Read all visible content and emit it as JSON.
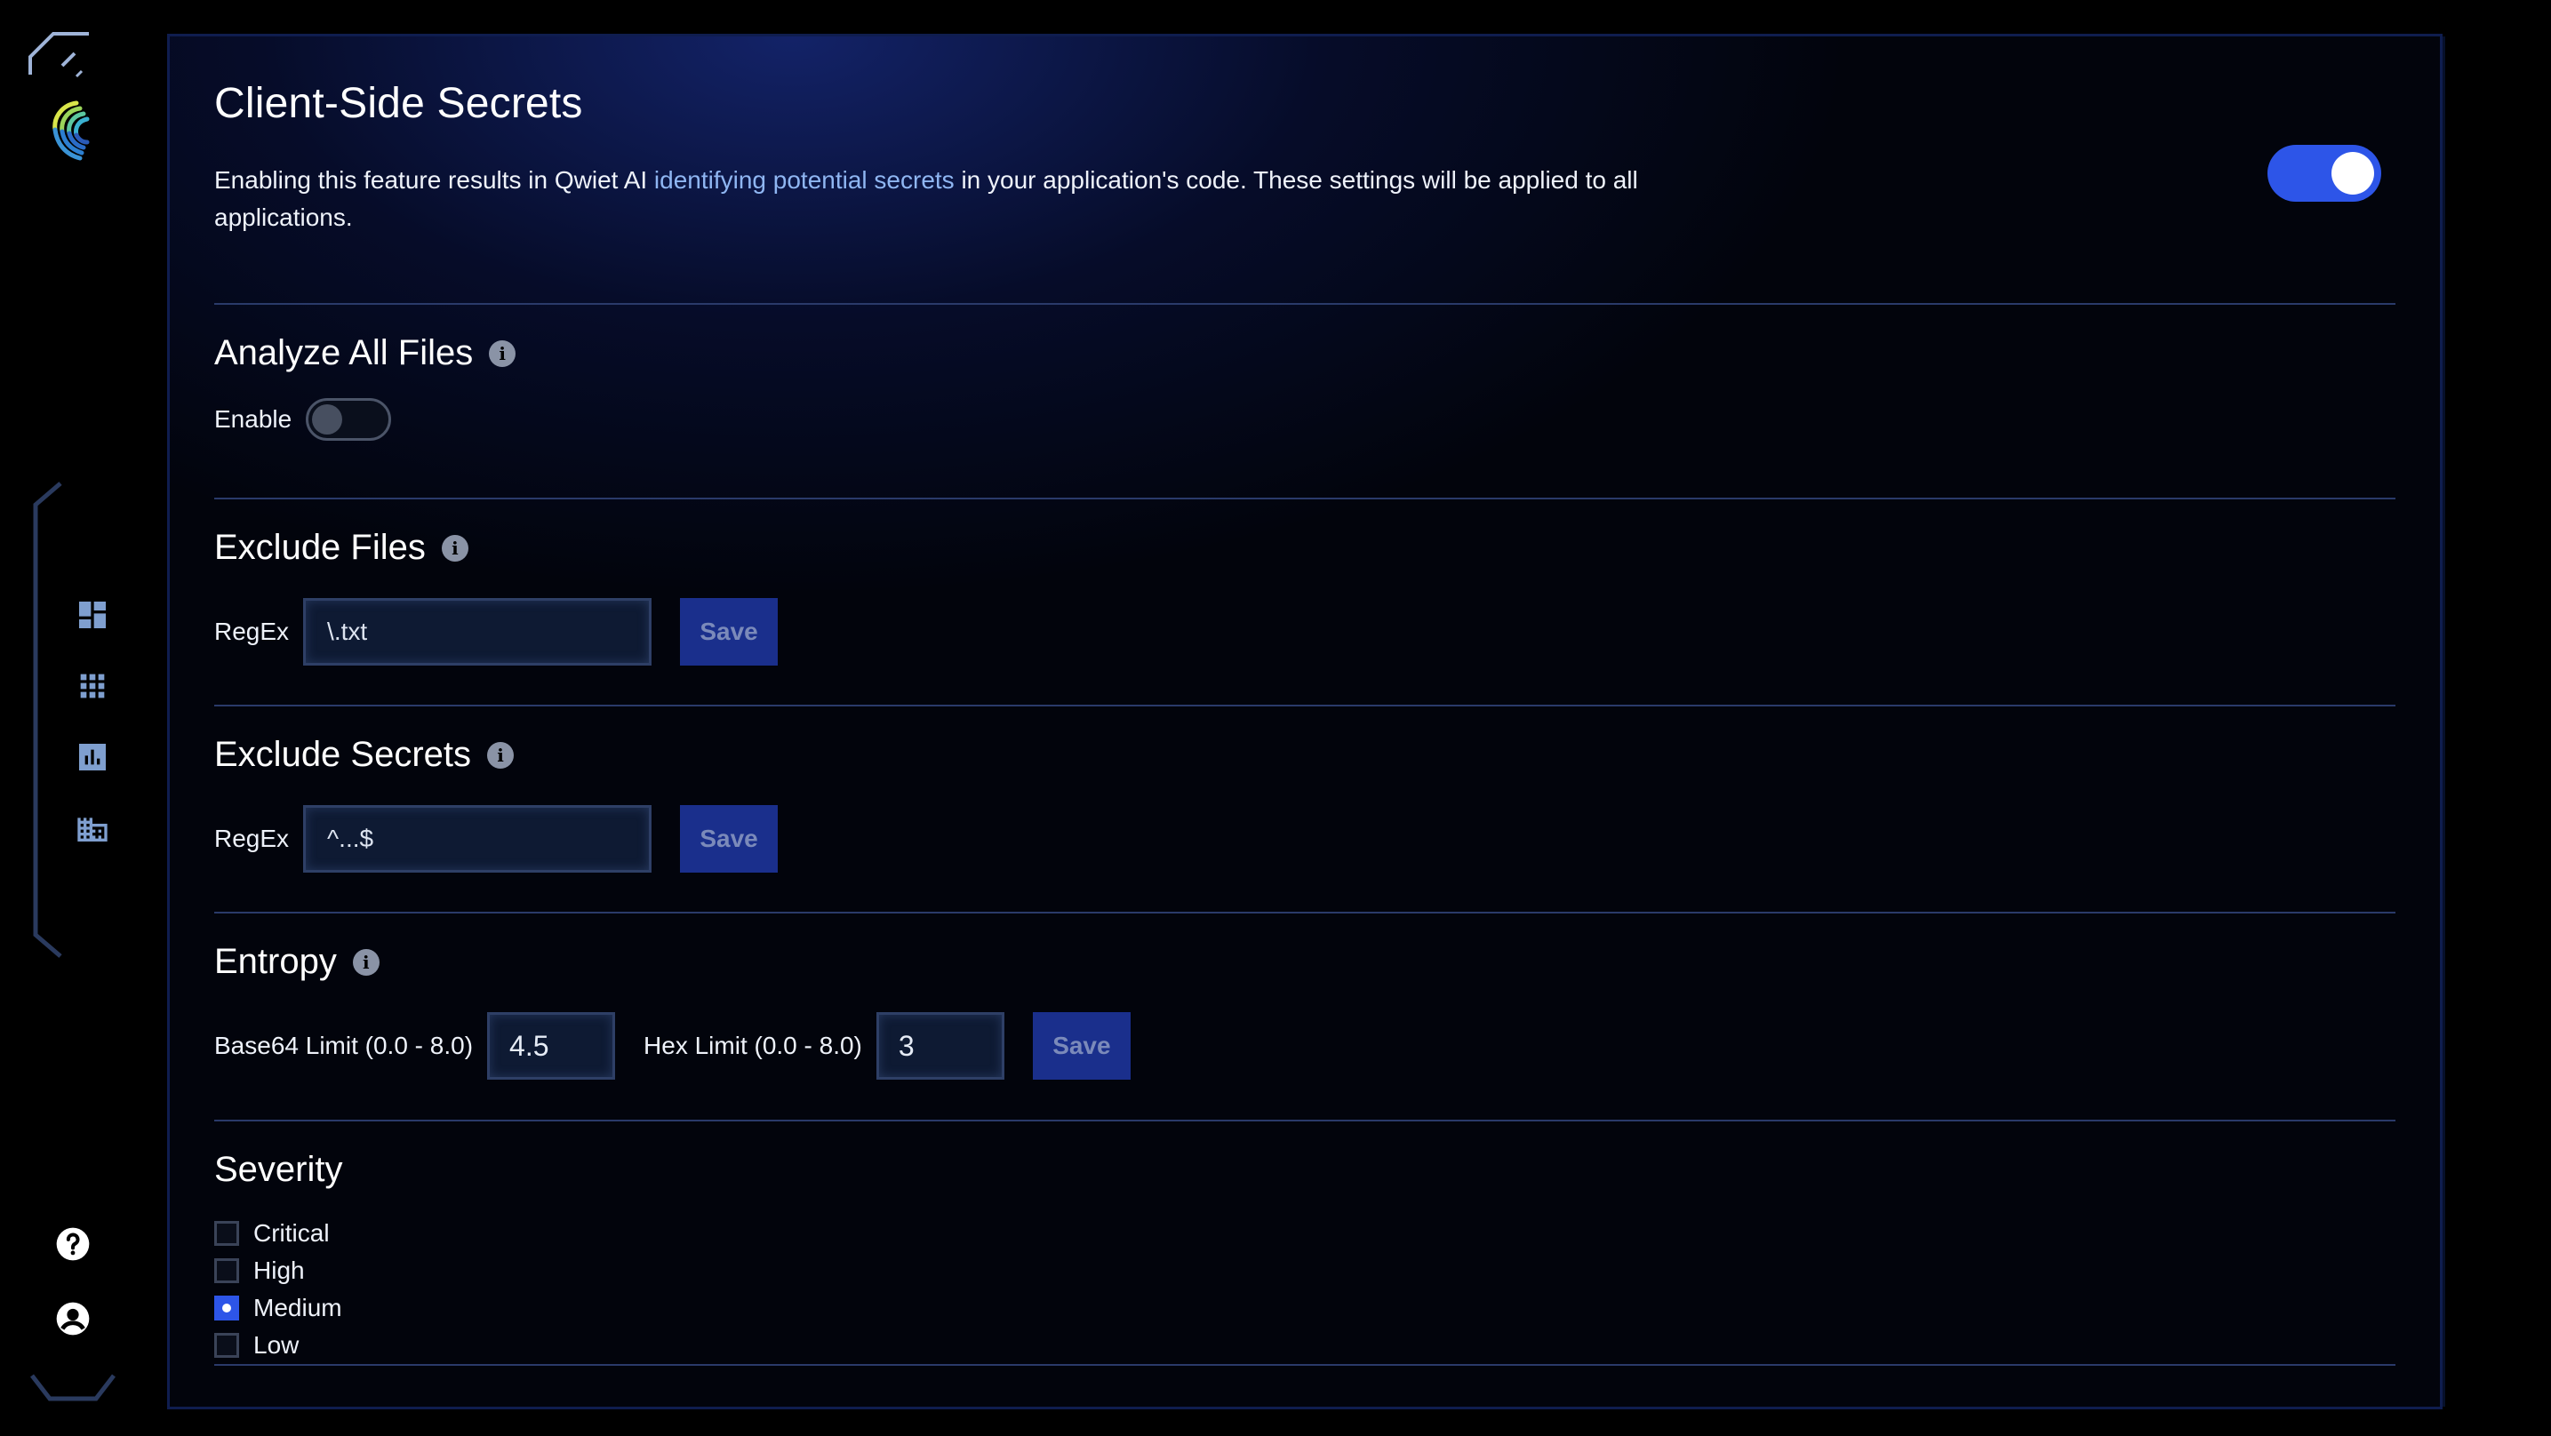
{
  "main": {
    "title": "Client-Side Secrets",
    "description_before": "Enabling this feature results in Qwiet AI ",
    "description_link": "identifying potential secrets",
    "description_after": " in your application's code. These settings will be applied to all applications.",
    "enabled": true
  },
  "analyze_all_files": {
    "title": "Analyze All Files",
    "enable_label": "Enable",
    "enabled": false
  },
  "exclude_files": {
    "title": "Exclude Files",
    "regex_label": "RegEx",
    "regex_value": "\\.txt",
    "save_label": "Save"
  },
  "exclude_secrets": {
    "title": "Exclude Secrets",
    "regex_label": "RegEx",
    "regex_value": "^...$",
    "save_label": "Save"
  },
  "entropy": {
    "title": "Entropy",
    "base64_label": "Base64 Limit (0.0 - 8.0)",
    "base64_value": "4.5",
    "hex_label": "Hex Limit (0.0 - 8.0)",
    "hex_value": "3",
    "save_label": "Save"
  },
  "severity": {
    "title": "Severity",
    "options": [
      {
        "label": "Critical",
        "checked": false
      },
      {
        "label": "High",
        "checked": false
      },
      {
        "label": "Medium",
        "checked": true
      },
      {
        "label": "Low",
        "checked": false
      }
    ]
  },
  "sidebar": {
    "icons": [
      "dashboard-icon",
      "apps-grid-icon",
      "chart-icon",
      "organization-icon"
    ],
    "bottom_icons": [
      "help-icon",
      "account-icon"
    ]
  },
  "colors": {
    "accent": "#2d55e8",
    "link": "#8fb6f2",
    "save_button": "#1a2f8c"
  }
}
